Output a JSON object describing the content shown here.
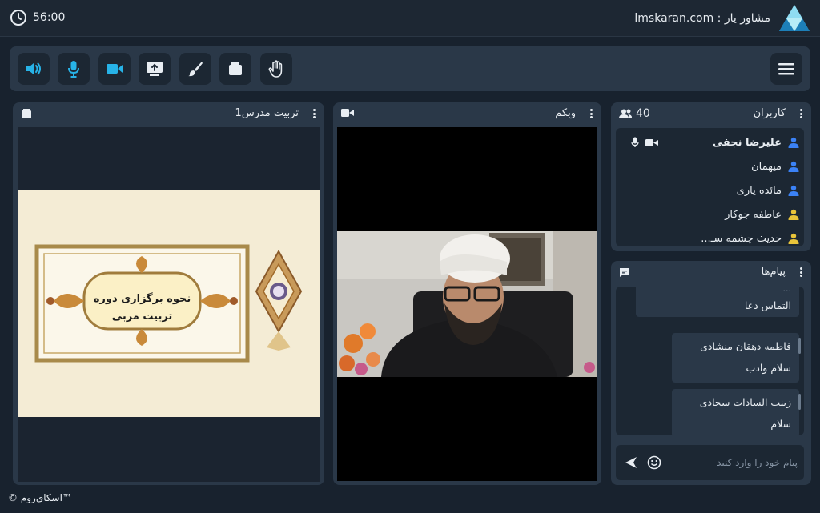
{
  "timer": {
    "value": "56:00"
  },
  "brand": {
    "text": "lmskaran.com : مشاور یار"
  },
  "toolbar": {
    "buttons": [
      {
        "name": "speaker",
        "icon": "speaker-icon",
        "active": true
      },
      {
        "name": "mic",
        "icon": "microphone-icon",
        "active": true
      },
      {
        "name": "camera",
        "icon": "video-camera-icon",
        "active": true
      },
      {
        "name": "screen-share",
        "icon": "screen-share-icon",
        "active": false
      },
      {
        "name": "whiteboard",
        "icon": "brush-icon",
        "active": false
      },
      {
        "name": "files",
        "icon": "folder-icon",
        "active": false
      },
      {
        "name": "raise-hand",
        "icon": "hand-icon",
        "active": false
      }
    ],
    "menu_icon": "hamburger-menu-icon"
  },
  "presentation_panel": {
    "title": "تربیت مدرس1",
    "slide": {
      "line1": "نحوه برگزاری دوره",
      "line2": "تربیت مربی"
    }
  },
  "webcam_panel": {
    "title": "وبکم"
  },
  "users_panel": {
    "title": "کاربران",
    "count": "40",
    "users": [
      {
        "name": "علیرضا نجفی",
        "role": "presenter",
        "color": "#3b82f6",
        "bold": true
      },
      {
        "name": "میهمان",
        "role": "participant",
        "color": "#3b82f6",
        "bold": false
      },
      {
        "name": "مائده یاری",
        "role": "participant",
        "color": "#3b82f6",
        "bold": false
      },
      {
        "name": "عاطفه جوکار",
        "role": "participant",
        "color": "#e8c43a",
        "bold": false
      },
      {
        "name": "حدیث چشمه سـ...",
        "role": "participant",
        "color": "#e8c43a",
        "bold": false
      }
    ]
  },
  "messages_panel": {
    "title": "پیام‌ها",
    "messages": [
      {
        "author": "...",
        "text": "التماس دعا"
      },
      {
        "author": "فاطمه دهقان منشادی",
        "text": "سلام وادب"
      },
      {
        "author": "زینب السادات سجادی",
        "text": "سلام"
      }
    ],
    "input_placeholder": "پیام خود را وارد کنید"
  },
  "footer": {
    "text": "© اسکای‌روم™"
  },
  "colors": {
    "accent": "#27b3e8",
    "panel": "#2a3848",
    "background": "#18222e"
  }
}
